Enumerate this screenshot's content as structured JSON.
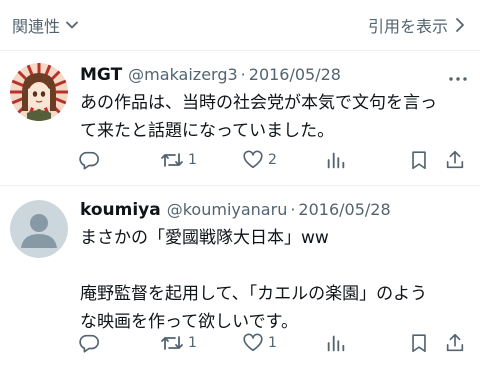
{
  "header": {
    "sort_label": "関連性",
    "quote_label": "引用を表示"
  },
  "posts": [
    {
      "name": "MGT",
      "handle": "@makaizerg3",
      "separator": "·",
      "date": "2016/05/28",
      "lines": [
        "あの作品は、当時の社会党が本気で文句を言っ",
        "て来たと話題になっていました。"
      ],
      "counts": {
        "reply": "",
        "repost": "1",
        "like": "2"
      }
    },
    {
      "name": "koumiya",
      "handle": "@koumiyanaru",
      "separator": "·",
      "date": "2016/05/28",
      "lines": [
        "まさかの「愛國戦隊大日本」ww",
        "",
        "庵野監督を起用して、「カエルの楽園」のよう",
        "な映画を作って欲しいです。"
      ],
      "counts": {
        "reply": "",
        "repost": "1",
        "like": "1"
      }
    }
  ],
  "icons": {
    "sort_chevron": "chevron-down-icon",
    "quote_chevron": "chevron-right-icon",
    "reply": "reply-icon",
    "repost": "repost-icon",
    "like": "heart-icon",
    "views": "views-icon",
    "bookmark": "bookmark-icon",
    "share": "share-icon",
    "more": "more-icon"
  },
  "colors": {
    "text_primary": "#0f1419",
    "text_secondary": "#536471",
    "divider": "#eff3f4",
    "icon": "#536471"
  }
}
